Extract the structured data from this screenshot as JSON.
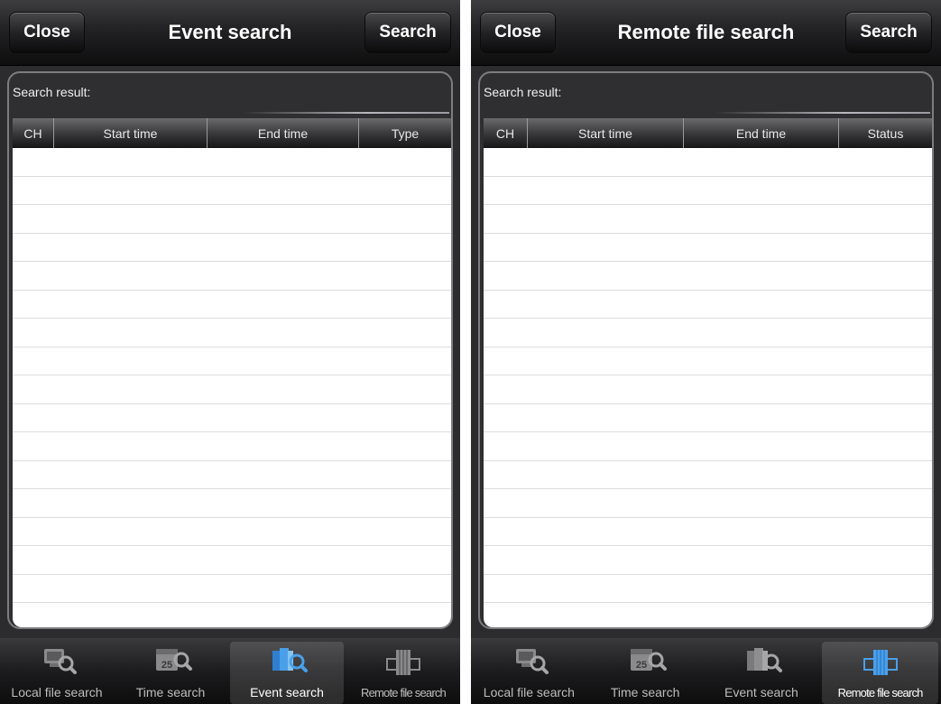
{
  "screens": [
    {
      "close_label": "Close",
      "title": "Event search",
      "search_label": "Search",
      "result_label": "Search result:",
      "columns": [
        "CH",
        "Start time",
        "End time",
        "Type"
      ],
      "tabs": [
        {
          "label": "Local file search",
          "icon": "local-file-search-icon"
        },
        {
          "label": "Time search",
          "icon": "time-search-icon"
        },
        {
          "label": "Event search",
          "icon": "event-search-icon"
        },
        {
          "label": "Remote file search",
          "icon": "remote-file-search-icon"
        }
      ],
      "active_tab": 2
    },
    {
      "close_label": "Close",
      "title": "Remote file search",
      "search_label": "Search",
      "result_label": "Search result:",
      "columns": [
        "CH",
        "Start time",
        "End time",
        "Status"
      ],
      "tabs": [
        {
          "label": "Local file search",
          "icon": "local-file-search-icon"
        },
        {
          "label": "Time search",
          "icon": "time-search-icon"
        },
        {
          "label": "Event search",
          "icon": "event-search-icon"
        },
        {
          "label": "Remote file search",
          "icon": "remote-file-search-icon"
        }
      ],
      "active_tab": 3
    }
  ],
  "calendar_day": "25",
  "colors": {
    "background": "#2c2c2e",
    "table_body": "#ffffff",
    "active_icon": "#4aa0e8"
  }
}
